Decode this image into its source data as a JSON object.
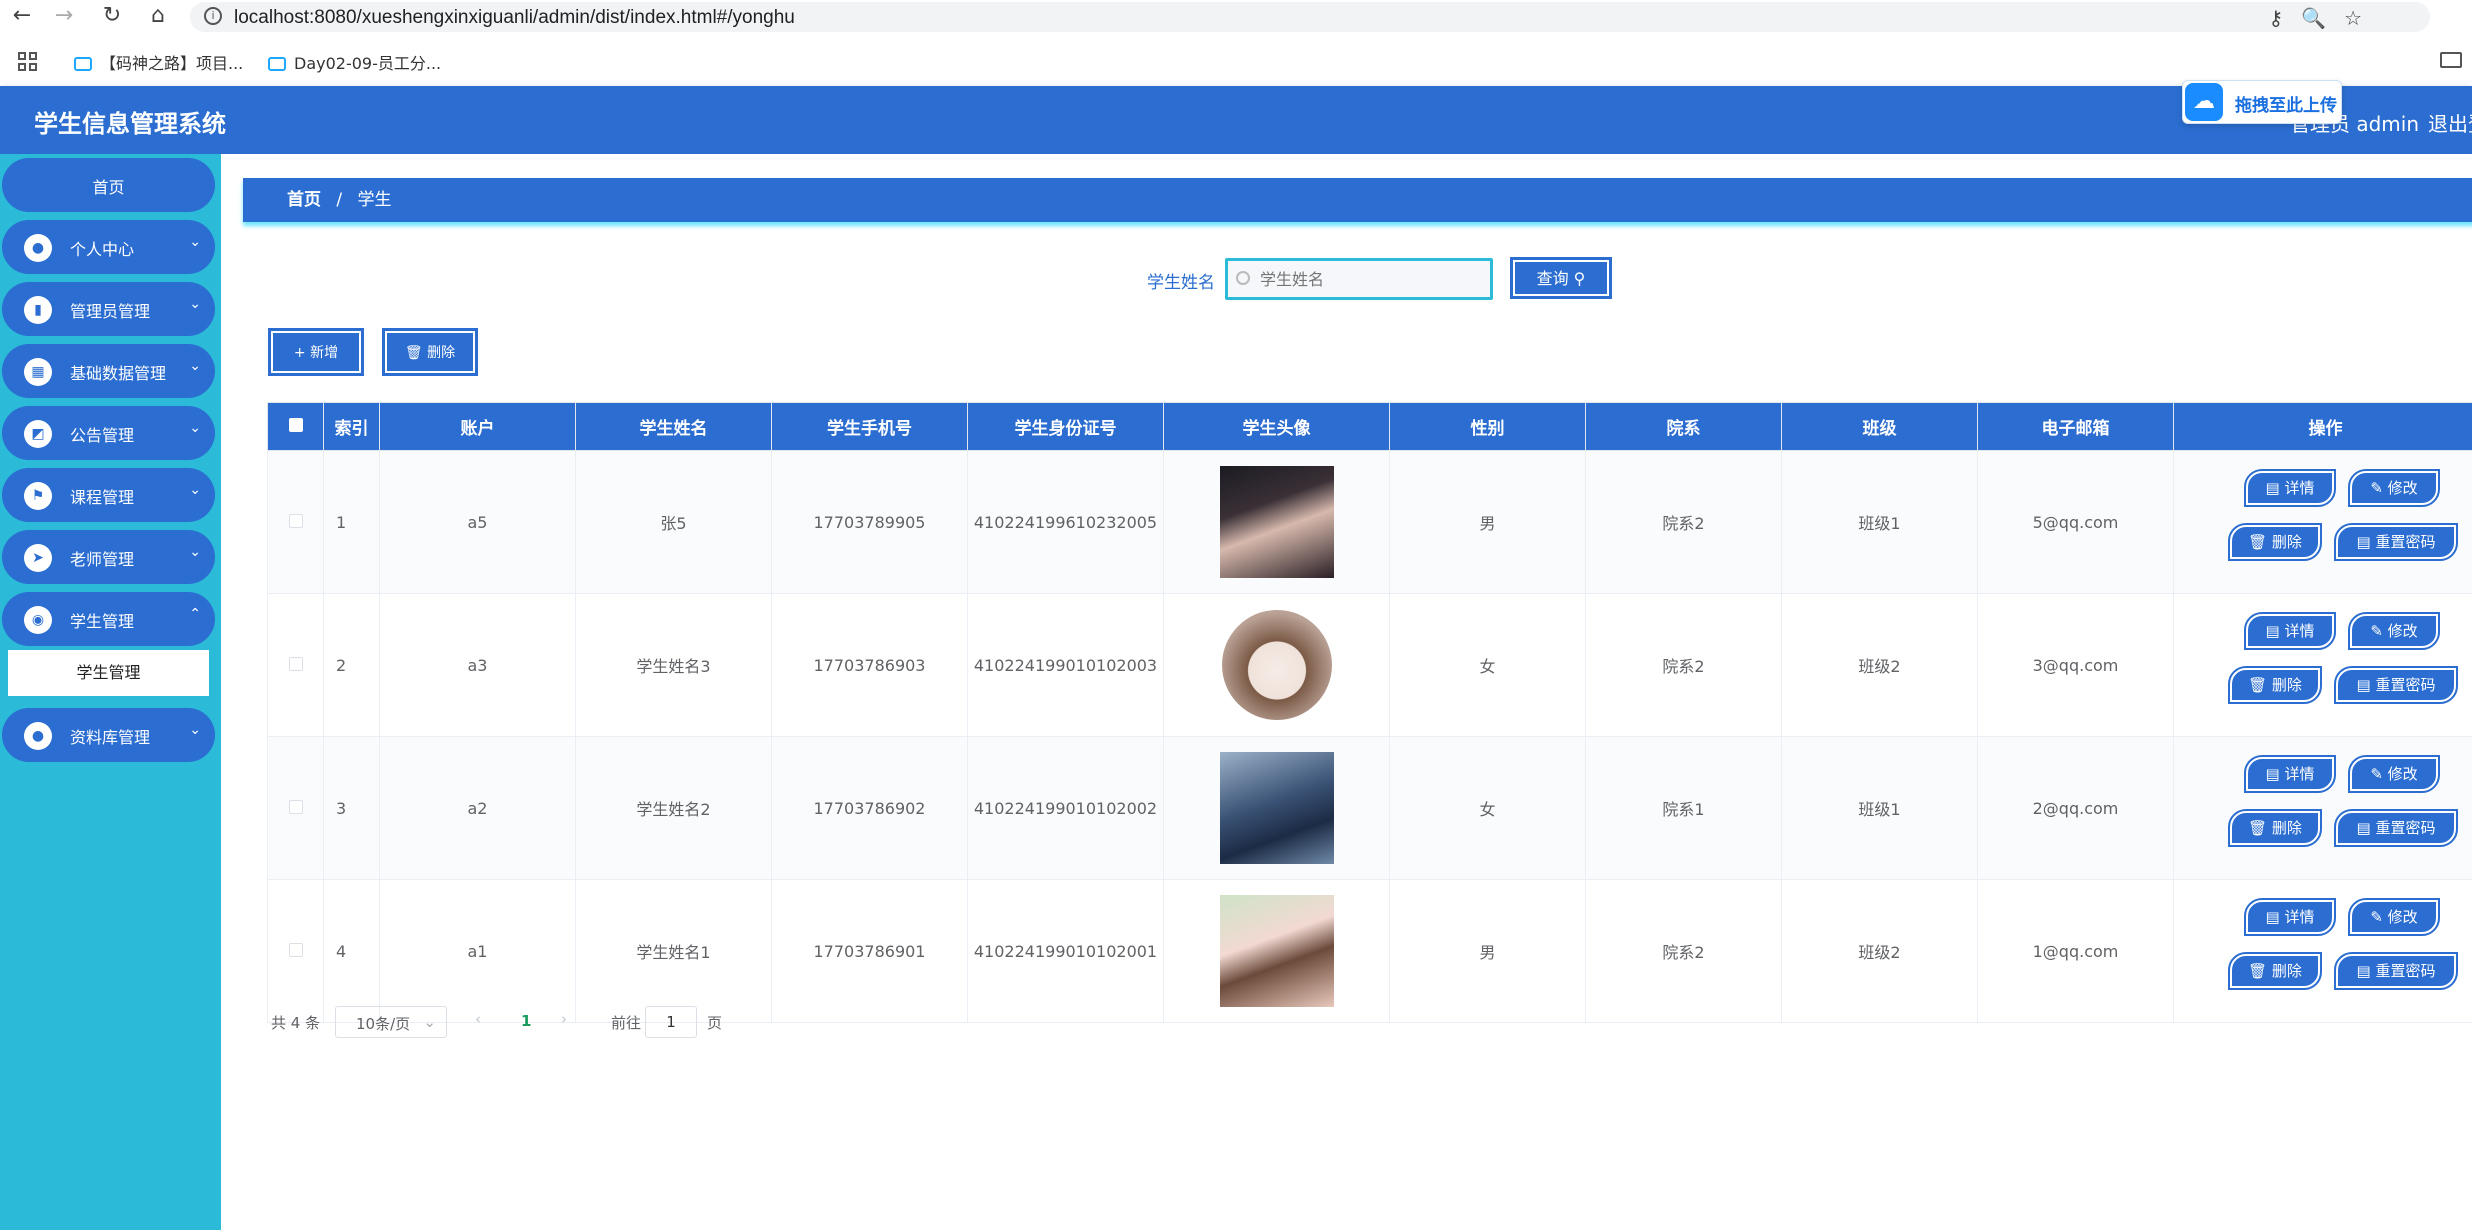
{
  "browser": {
    "url": "localhost:8080/xueshengxinxiguanli/admin/dist/index.html#/yonghu",
    "bookmarks": [
      "【码神之路】项目...",
      "Day02-09-员工分..."
    ]
  },
  "header": {
    "title": "学生信息管理系统",
    "user": "管理员 admin",
    "logout": "退出登录",
    "upload_float": "拖拽至此上传"
  },
  "sidebar": {
    "home": "首页",
    "items": [
      {
        "label": "个人中心",
        "icon": "user-icon"
      },
      {
        "label": "管理员管理",
        "icon": "bar-chart-icon"
      },
      {
        "label": "基础数据管理",
        "icon": "grid-icon"
      },
      {
        "label": "公告管理",
        "icon": "chart-icon"
      },
      {
        "label": "课程管理",
        "icon": "flag-icon"
      },
      {
        "label": "老师管理",
        "icon": "send-icon"
      },
      {
        "label": "学生管理",
        "icon": "location-icon"
      },
      {
        "label": "资料库管理",
        "icon": "user-icon"
      }
    ],
    "submenu": "学生管理"
  },
  "breadcrumb": {
    "home": "首页",
    "separator": "/",
    "current": "学生"
  },
  "search": {
    "label": "学生姓名",
    "placeholder": "学生姓名",
    "query_button": "查询 ⚲"
  },
  "toolbar": {
    "add": "+ 新增",
    "delete": "🗑 删除"
  },
  "table": {
    "headers": [
      "索引",
      "账户",
      "学生姓名",
      "学生手机号",
      "学生身份证号",
      "学生头像",
      "性别",
      "院系",
      "班级",
      "电子邮箱",
      "操作"
    ],
    "rows": [
      {
        "index": "1",
        "account": "a5",
        "name": "张5",
        "phone": "17703789905",
        "id_card": "410224199610232005",
        "gender": "男",
        "department": "院系2",
        "class": "班级1",
        "email": "5@qq.com"
      },
      {
        "index": "2",
        "account": "a3",
        "name": "学生姓名3",
        "phone": "17703786903",
        "id_card": "410224199010102003",
        "gender": "女",
        "department": "院系2",
        "class": "班级2",
        "email": "3@qq.com"
      },
      {
        "index": "3",
        "account": "a2",
        "name": "学生姓名2",
        "phone": "17703786902",
        "id_card": "410224199010102002",
        "gender": "女",
        "department": "院系1",
        "class": "班级1",
        "email": "2@qq.com"
      },
      {
        "index": "4",
        "account": "a1",
        "name": "学生姓名1",
        "phone": "17703786901",
        "id_card": "410224199010102001",
        "gender": "男",
        "department": "院系2",
        "class": "班级2",
        "email": "1@qq.com"
      }
    ],
    "actions": {
      "detail": "详情",
      "edit": "修改",
      "delete": "删除",
      "reset": "重置密码"
    }
  },
  "pagination": {
    "total": "共 4 条",
    "page_size": "10条/页",
    "current_page": "1",
    "goto_prefix": "前往",
    "goto_value": "1",
    "goto_suffix": "页"
  },
  "colors": {
    "primary": "#2b6dd0",
    "sidebar": "#2bbbd8",
    "glow": "#6fe6ff"
  }
}
